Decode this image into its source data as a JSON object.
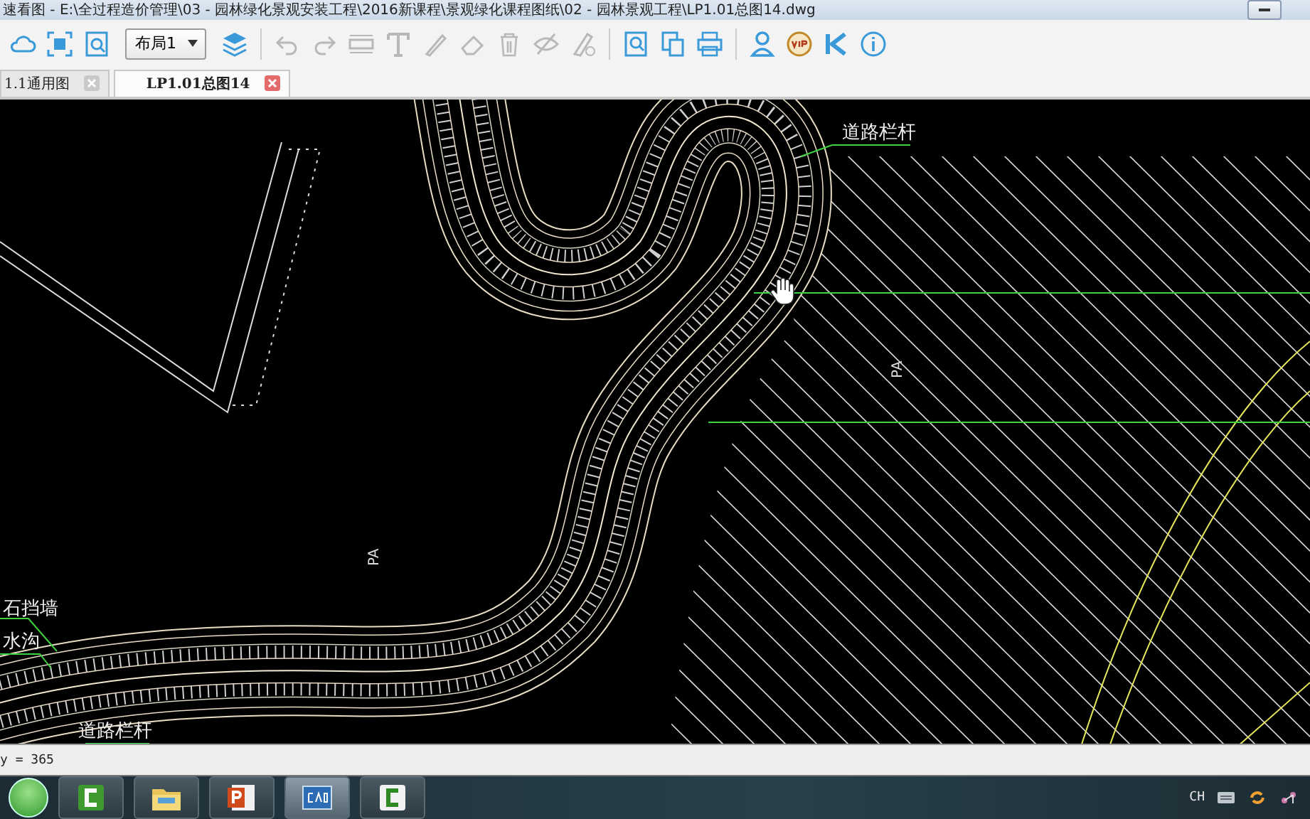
{
  "window": {
    "title": "速看图 - E:\\全过程造价管理\\03 - 园林绿化景观安装工程\\2016新课程\\景观绿化课程图纸\\02 - 园林景观工程\\LP1.01总图14.dwg"
  },
  "toolbar": {
    "layout_dropdown": "布局1"
  },
  "tabs": [
    {
      "label": "1.1通用图",
      "selected": false
    },
    {
      "label": "LP1.01总图14",
      "selected": true
    }
  ],
  "drawing": {
    "labels": [
      {
        "text": "道路栏杆"
      },
      {
        "text": "PA"
      },
      {
        "text": "PA"
      },
      {
        "text": "石挡墙"
      },
      {
        "text": "水沟"
      },
      {
        "text": "道路栏杆"
      }
    ]
  },
  "status_bar": {
    "text": "y = 365"
  },
  "taskbar": {
    "language": "CH"
  }
}
